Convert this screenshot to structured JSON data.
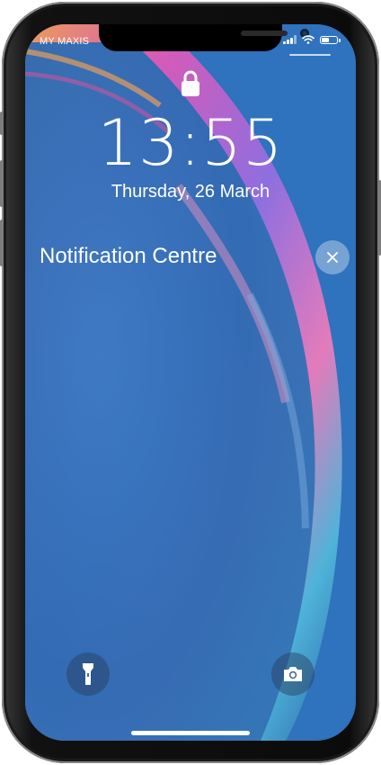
{
  "status_bar": {
    "carrier": "MY MAXIS",
    "battery_level": 0.55
  },
  "lock_screen": {
    "time": "13:55",
    "date": "Thursday, 26 March"
  },
  "notification_centre": {
    "title": "Notification Centre"
  },
  "quick_actions": {
    "left_icon": "flashlight-icon",
    "right_icon": "camera-icon"
  },
  "colors": {
    "wallpaper_base": "#2f6fb5",
    "text": "#ffffff"
  }
}
